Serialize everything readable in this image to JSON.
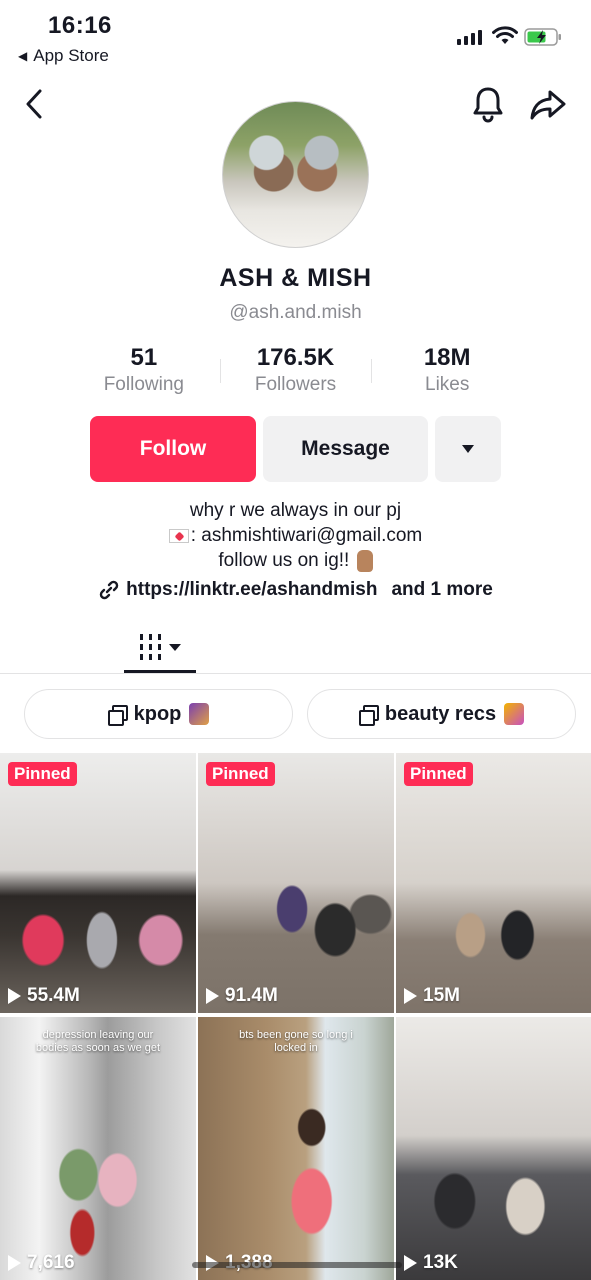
{
  "status_bar": {
    "time": "16:16",
    "back_app": "App Store"
  },
  "nav": {
    "back_icon": "chevron-left-icon",
    "bell_icon": "bell-icon",
    "share_icon": "share-arrow-icon"
  },
  "profile": {
    "display_name": "ASH & MISH",
    "username": "@ash.and.mish",
    "stats": [
      {
        "value": "51",
        "label": "Following"
      },
      {
        "value": "176.5K",
        "label": "Followers"
      },
      {
        "value": "18M",
        "label": "Likes"
      }
    ],
    "buttons": {
      "follow": "Follow",
      "message": "Message",
      "more_icon": "caret-down-icon"
    },
    "bio": {
      "line1": "why r we always in our pj",
      "line2": ": ashmishtiwari@gmail.com",
      "line3": "follow us on ig!! ",
      "link": "https://linktr.ee/ashandmish",
      "link_more": "and 1 more"
    }
  },
  "tabs": {
    "videos_icon": "videos-grid-icon",
    "repost_icon": "repost-icon"
  },
  "playlists": [
    {
      "label": "kpop"
    },
    {
      "label": "beauty recs"
    }
  ],
  "videos": [
    {
      "pinned": "Pinned",
      "views": "55.4M"
    },
    {
      "pinned": "Pinned",
      "views": "91.4M"
    },
    {
      "pinned": "Pinned",
      "views": "15M"
    },
    {
      "caption": "depression leaving our bodies as soon as we get",
      "views": "7,616"
    },
    {
      "caption": "bts been gone so long i locked in",
      "views": "1,388"
    },
    {
      "views": "13K"
    }
  ],
  "colors": {
    "accent": "#fe2c55",
    "text": "#161823",
    "muted": "#8a8b91",
    "button_bg": "#f1f1f2"
  }
}
